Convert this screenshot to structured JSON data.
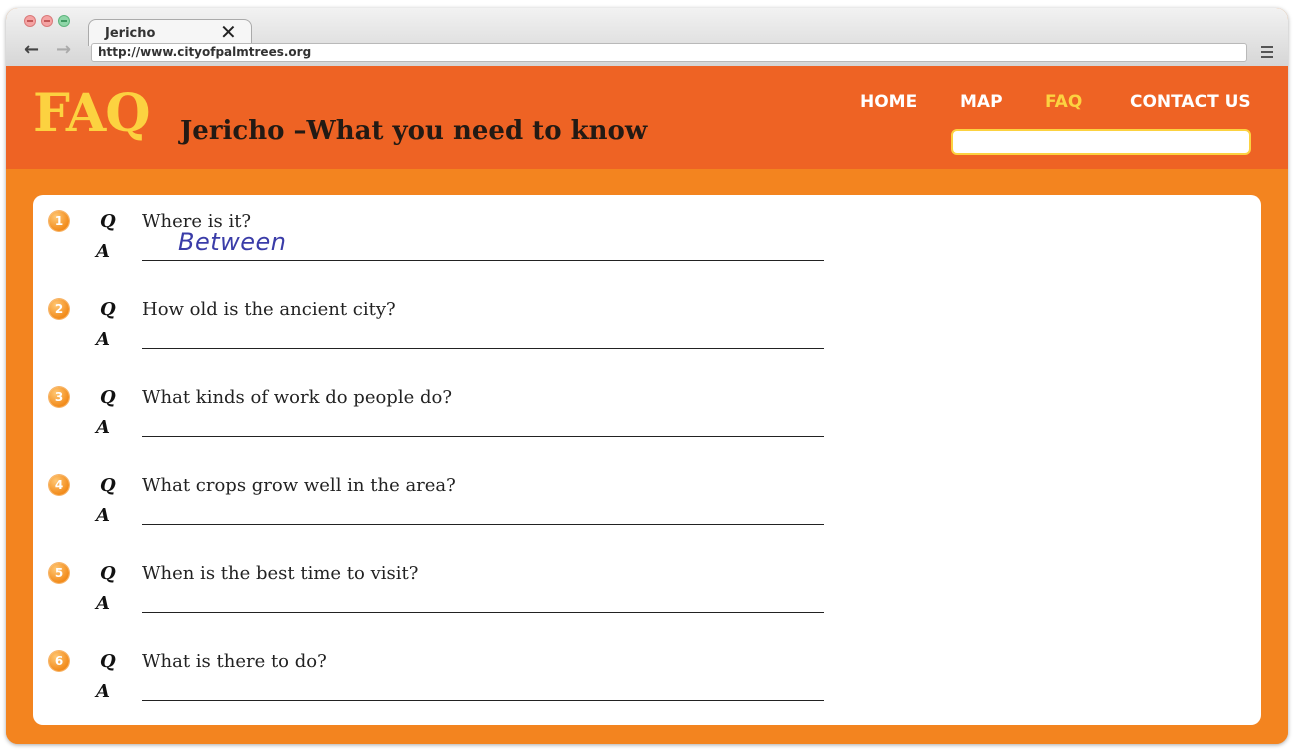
{
  "browser": {
    "tab_title": "Jericho",
    "tab_close": "✕",
    "back": "←",
    "forward": "→",
    "url": "http://www.cityofpalmtrees.org"
  },
  "header": {
    "logo": "FAQ",
    "subtitle": "Jericho –What you need to know",
    "nav": [
      "HOME",
      "MAP",
      "FAQ",
      "CONTACT US"
    ],
    "active_nav": "FAQ",
    "search_value": ""
  },
  "faq": {
    "q_label": "Q",
    "a_label": "A",
    "items": [
      {
        "num": "1",
        "question": "Where is it?",
        "answer": "Between"
      },
      {
        "num": "2",
        "question": "How old is the ancient city?",
        "answer": ""
      },
      {
        "num": "3",
        "question": "What kinds of work do people do?",
        "answer": ""
      },
      {
        "num": "4",
        "question": "What crops grow well in the area?",
        "answer": ""
      },
      {
        "num": "5",
        "question": "When is the best time to visit?",
        "answer": ""
      },
      {
        "num": "6",
        "question": "What is there to do?",
        "answer": ""
      }
    ]
  },
  "colors": {
    "header_orange": "#ee6324",
    "body_orange": "#f3841f",
    "accent_yellow": "#fcd240",
    "handwriting_blue": "#3a3ca8"
  }
}
